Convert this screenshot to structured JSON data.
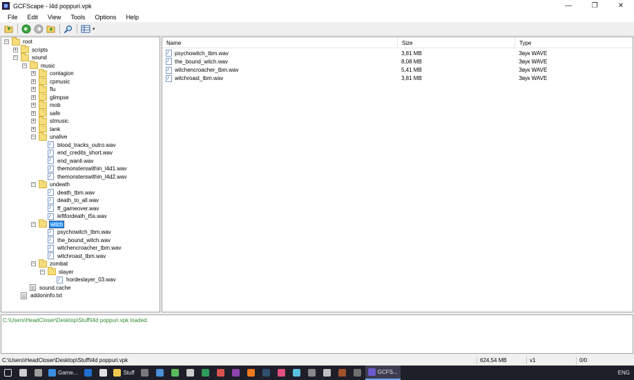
{
  "window": {
    "title": "GCFScape - l4d poppuri.vpk",
    "minimize_glyph": "—",
    "maximize_glyph": "❐",
    "close_glyph": "✕"
  },
  "menu": [
    "File",
    "Edit",
    "View",
    "Tools",
    "Options",
    "Help"
  ],
  "toolbar": {
    "icons": [
      "open-icon",
      "back-icon",
      "forward-icon",
      "up-icon",
      "find-icon",
      "view-mode-icon"
    ],
    "dropdown_glyph": "▾"
  },
  "tree": [
    {
      "label": "root",
      "depth": 0,
      "expander": "−",
      "icon": "folder"
    },
    {
      "label": "scripts",
      "depth": 1,
      "expander": "+",
      "icon": "folder"
    },
    {
      "label": "sound",
      "depth": 1,
      "expander": "−",
      "icon": "folder"
    },
    {
      "label": "music",
      "depth": 2,
      "expander": "−",
      "icon": "folder"
    },
    {
      "label": "contagion",
      "depth": 3,
      "expander": "+",
      "icon": "folder"
    },
    {
      "label": "cpmusic",
      "depth": 3,
      "expander": "+",
      "icon": "folder"
    },
    {
      "label": "flu",
      "depth": 3,
      "expander": "+",
      "icon": "folder"
    },
    {
      "label": "glimpse",
      "depth": 3,
      "expander": "+",
      "icon": "folder"
    },
    {
      "label": "mob",
      "depth": 3,
      "expander": "+",
      "icon": "folder"
    },
    {
      "label": "safe",
      "depth": 3,
      "expander": "+",
      "icon": "folder"
    },
    {
      "label": "stmusic",
      "depth": 3,
      "expander": "+",
      "icon": "folder"
    },
    {
      "label": "tank",
      "depth": 3,
      "expander": "+",
      "icon": "folder"
    },
    {
      "label": "unalive",
      "depth": 3,
      "expander": "−",
      "icon": "folder"
    },
    {
      "label": "blood_tracks_outro.wav",
      "depth": 4,
      "expander": "",
      "icon": "file"
    },
    {
      "label": "end_credits_short.wav",
      "depth": 4,
      "expander": "",
      "icon": "file"
    },
    {
      "label": "end_wanli.wav",
      "depth": 4,
      "expander": "",
      "icon": "file"
    },
    {
      "label": "themonsterswithin_l4d1.wav",
      "depth": 4,
      "expander": "",
      "icon": "file"
    },
    {
      "label": "themonsterswithin_l4d2.wav",
      "depth": 4,
      "expander": "",
      "icon": "file"
    },
    {
      "label": "undeath",
      "depth": 3,
      "expander": "−",
      "icon": "folder"
    },
    {
      "label": "death_tbm.wav",
      "depth": 4,
      "expander": "",
      "icon": "file"
    },
    {
      "label": "death_to_all.wav",
      "depth": 4,
      "expander": "",
      "icon": "file"
    },
    {
      "label": "ff_gameover.wav",
      "depth": 4,
      "expander": "",
      "icon": "file"
    },
    {
      "label": "leftfordeath_t5s.wav",
      "depth": 4,
      "expander": "",
      "icon": "file"
    },
    {
      "label": "witch",
      "depth": 3,
      "expander": "−",
      "icon": "folder",
      "selected": true
    },
    {
      "label": "psychowitch_tbm.wav",
      "depth": 4,
      "expander": "",
      "icon": "file"
    },
    {
      "label": "the_bound_witch.wav",
      "depth": 4,
      "expander": "",
      "icon": "file"
    },
    {
      "label": "witchencroacher_tbm.wav",
      "depth": 4,
      "expander": "",
      "icon": "file"
    },
    {
      "label": "witchroast_tbm.wav",
      "depth": 4,
      "expander": "",
      "icon": "file"
    },
    {
      "label": "zombat",
      "depth": 3,
      "expander": "−",
      "icon": "folder"
    },
    {
      "label": "slayer",
      "depth": 4,
      "expander": "−",
      "icon": "folder"
    },
    {
      "label": "hordeslayer_03.wav",
      "depth": 5,
      "expander": "",
      "icon": "file"
    },
    {
      "label": "sound.cache",
      "depth": 2,
      "expander": "",
      "icon": "text"
    },
    {
      "label": "addoninfo.txt",
      "depth": 1,
      "expander": "",
      "icon": "text"
    }
  ],
  "list": {
    "columns": [
      "Name",
      "Size",
      "Type"
    ],
    "rows": [
      {
        "name": "psychowitch_tbm.wav",
        "size": "3,81 MB",
        "type": "Звук WAVE"
      },
      {
        "name": "the_bound_witch.wav",
        "size": "8,08 MB",
        "type": "Звук WAVE"
      },
      {
        "name": "witchencroacher_tbm.wav",
        "size": "5,41 MB",
        "type": "Звук WAVE"
      },
      {
        "name": "witchroast_tbm.wav",
        "size": "3,81 MB",
        "type": "Звук WAVE"
      }
    ]
  },
  "log": {
    "line": "C:\\Users\\HeadCloser\\Desktop\\Stuff\\l4d poppuri.vpk loaded.",
    "color": "#2e8b2e"
  },
  "status": {
    "path": "C:\\Users\\HeadCloser\\Desktop\\Stuff\\l4d poppuri.vpk",
    "size": "624,54 MB",
    "version": "v1",
    "count": "0/0"
  },
  "taskbar": {
    "items": [
      {
        "icon": "start-icon",
        "label": ""
      },
      {
        "icon": "task-view-icon",
        "label": ""
      },
      {
        "icon": "terminal-icon",
        "label": ""
      },
      {
        "icon": "edge-icon",
        "label": "Game..."
      },
      {
        "icon": "ie-icon",
        "label": ""
      },
      {
        "icon": "chrome-icon",
        "label": ""
      },
      {
        "icon": "folder-icon",
        "label": "Stuff"
      },
      {
        "icon": "store-icon",
        "label": ""
      },
      {
        "icon": "mail-icon",
        "label": ""
      },
      {
        "icon": "app-icon",
        "label": ""
      },
      {
        "icon": "search-icon",
        "label": ""
      },
      {
        "icon": "app-icon",
        "label": ""
      },
      {
        "icon": "app-icon",
        "label": ""
      },
      {
        "icon": "app-icon",
        "label": ""
      },
      {
        "icon": "firefox-icon",
        "label": ""
      },
      {
        "icon": "steam-icon",
        "label": ""
      },
      {
        "icon": "app-icon",
        "label": ""
      },
      {
        "icon": "app-icon",
        "label": ""
      },
      {
        "icon": "app-icon",
        "label": ""
      },
      {
        "icon": "app-icon",
        "label": ""
      },
      {
        "icon": "app-icon",
        "label": ""
      },
      {
        "icon": "app-icon",
        "label": ""
      },
      {
        "icon": "gcfscape-icon",
        "label": "GCFS...",
        "active": true
      }
    ],
    "tray_text": "ENG"
  }
}
